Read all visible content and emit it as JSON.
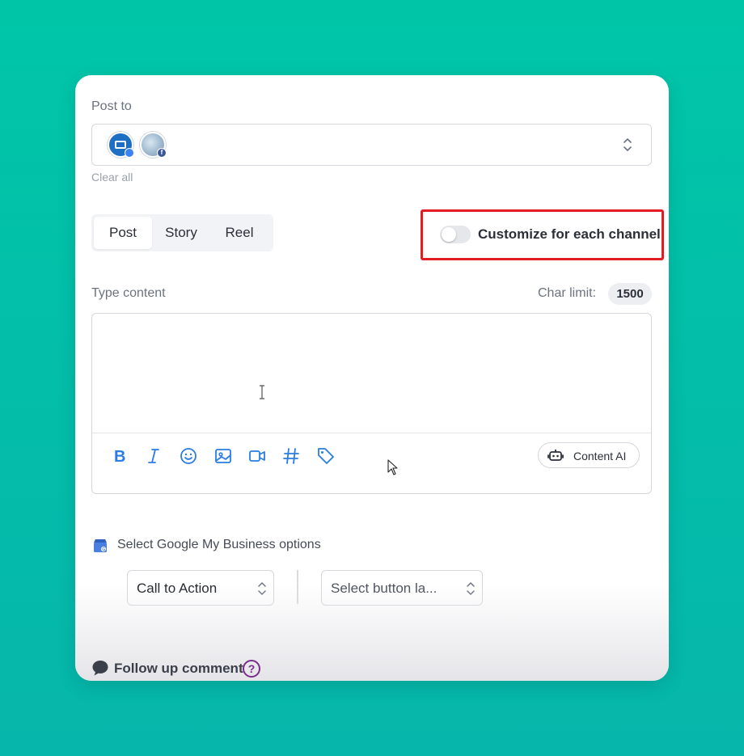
{
  "post_to": {
    "label": "Post to",
    "clear_all": "Clear all",
    "channels": [
      {
        "icon": "google-my-business-avatar",
        "badge_icon": "google-my-business-badge-icon"
      },
      {
        "icon": "facebook-page-avatar",
        "badge_icon": "facebook-badge-icon",
        "badge_text": "f"
      }
    ]
  },
  "post_types": {
    "tabs": [
      "Post",
      "Story",
      "Reel"
    ],
    "active": "Post"
  },
  "customize": {
    "label": "Customize for each channel",
    "enabled": false,
    "highlight_color": "#e31b23"
  },
  "content": {
    "label": "Type content",
    "char_limit_label": "Char limit:",
    "char_limit_value": "1500",
    "value": "",
    "toolbar_icons": [
      "bold-icon",
      "italic-icon",
      "emoji-icon",
      "image-icon",
      "video-icon",
      "hashtag-icon",
      "tag-icon"
    ],
    "content_ai_label": "Content AI"
  },
  "gmb": {
    "label": "Select Google My Business options",
    "call_to_action": "Call to Action",
    "button_label_placeholder": "Select button la..."
  },
  "follow_up": {
    "label": "Follow up comment",
    "help": "?"
  },
  "colors": {
    "background": "#00c2aa",
    "accent_blue": "#2a7de1",
    "help_purple": "#7b2d8b"
  }
}
